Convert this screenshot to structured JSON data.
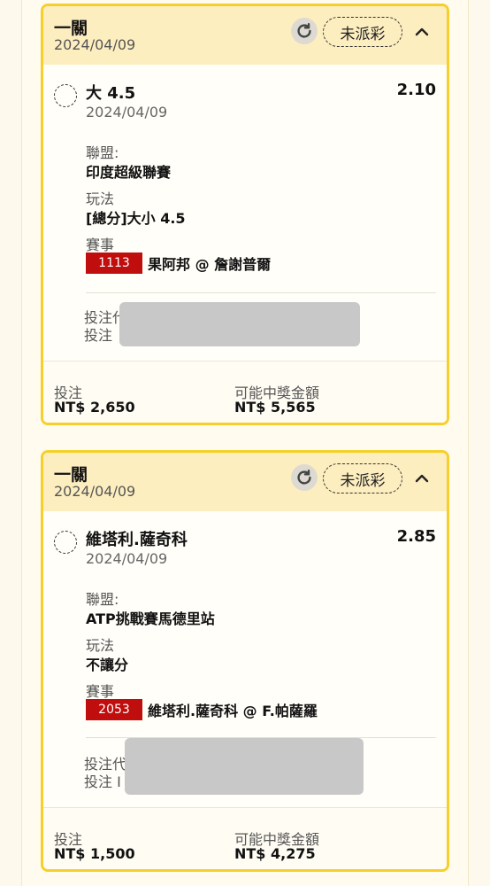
{
  "cards": [
    {
      "header": {
        "title": "一關",
        "date": "2024/04/09",
        "status": "未派彩"
      },
      "selection": {
        "name": "大 4.5",
        "odds": "2.10",
        "date": "2024/04/09"
      },
      "league_label": "聯盟:",
      "league": "印度超級聯賽",
      "market_label": "玩法",
      "market": "[總分]大小 4.5",
      "event_label": "賽事",
      "event_code": "1113",
      "event_name": "果阿邦 @ 詹謝普爾",
      "bet_meta_1": "投注代",
      "bet_meta_2": "投注",
      "footer": {
        "stake_label": "投注",
        "stake": "NT$ 2,650",
        "payout_label": "可能中獎金額",
        "payout": "NT$ 5,565"
      }
    },
    {
      "header": {
        "title": "一關",
        "date": "2024/04/09",
        "status": "未派彩"
      },
      "selection": {
        "name": "維塔利.薩奇科",
        "odds": "2.85",
        "date": "2024/04/09"
      },
      "league_label": "聯盟:",
      "league": "ATP挑戰賽馬德里站",
      "market_label": "玩法",
      "market": "不讓分",
      "event_label": "賽事",
      "event_code": "2053",
      "event_name": "維塔利.薩奇科 @ F.帕薩羅",
      "bet_meta_1": "投注代",
      "bet_meta_2": "投注 I",
      "footer": {
        "stake_label": "投注",
        "stake": "NT$ 1,500",
        "payout_label": "可能中獎金額",
        "payout": "NT$ 4,275"
      }
    }
  ],
  "icons": {
    "refresh": "refresh-icon",
    "collapse": "chevron-up-icon",
    "radio": "dashed-radio-icon"
  },
  "colors": {
    "accent": "#f6cf2b",
    "header_bg": "#fdeec0",
    "event_code_bg": "#c00d0d"
  }
}
